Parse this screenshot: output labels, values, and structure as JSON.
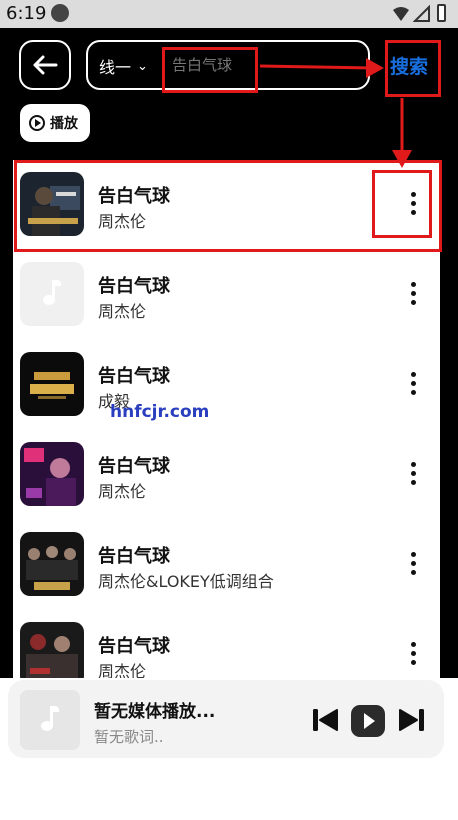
{
  "status_bar": {
    "time": "6:19"
  },
  "header": {
    "line_select": "线一",
    "search_value": "告白气球",
    "search_button": "搜索"
  },
  "play_all": "播放",
  "songs": [
    {
      "title": "告白气球",
      "artist": "周杰伦"
    },
    {
      "title": "告白气球",
      "artist": "周杰伦"
    },
    {
      "title": "告白气球",
      "artist": "成毅"
    },
    {
      "title": "告白气球",
      "artist": "周杰伦"
    },
    {
      "title": "告白气球",
      "artist": "周杰伦&LOKEY低调组合"
    },
    {
      "title": "告白气球",
      "artist": "周杰伦"
    }
  ],
  "watermark": "hnfcjr.com",
  "player": {
    "title": "暂无媒体播放...",
    "lyric": "暂无歌词.."
  },
  "colors": {
    "search_accent": "#1a6fe0",
    "annotation_red": "#e01a1a",
    "header_bg": "#000000"
  }
}
